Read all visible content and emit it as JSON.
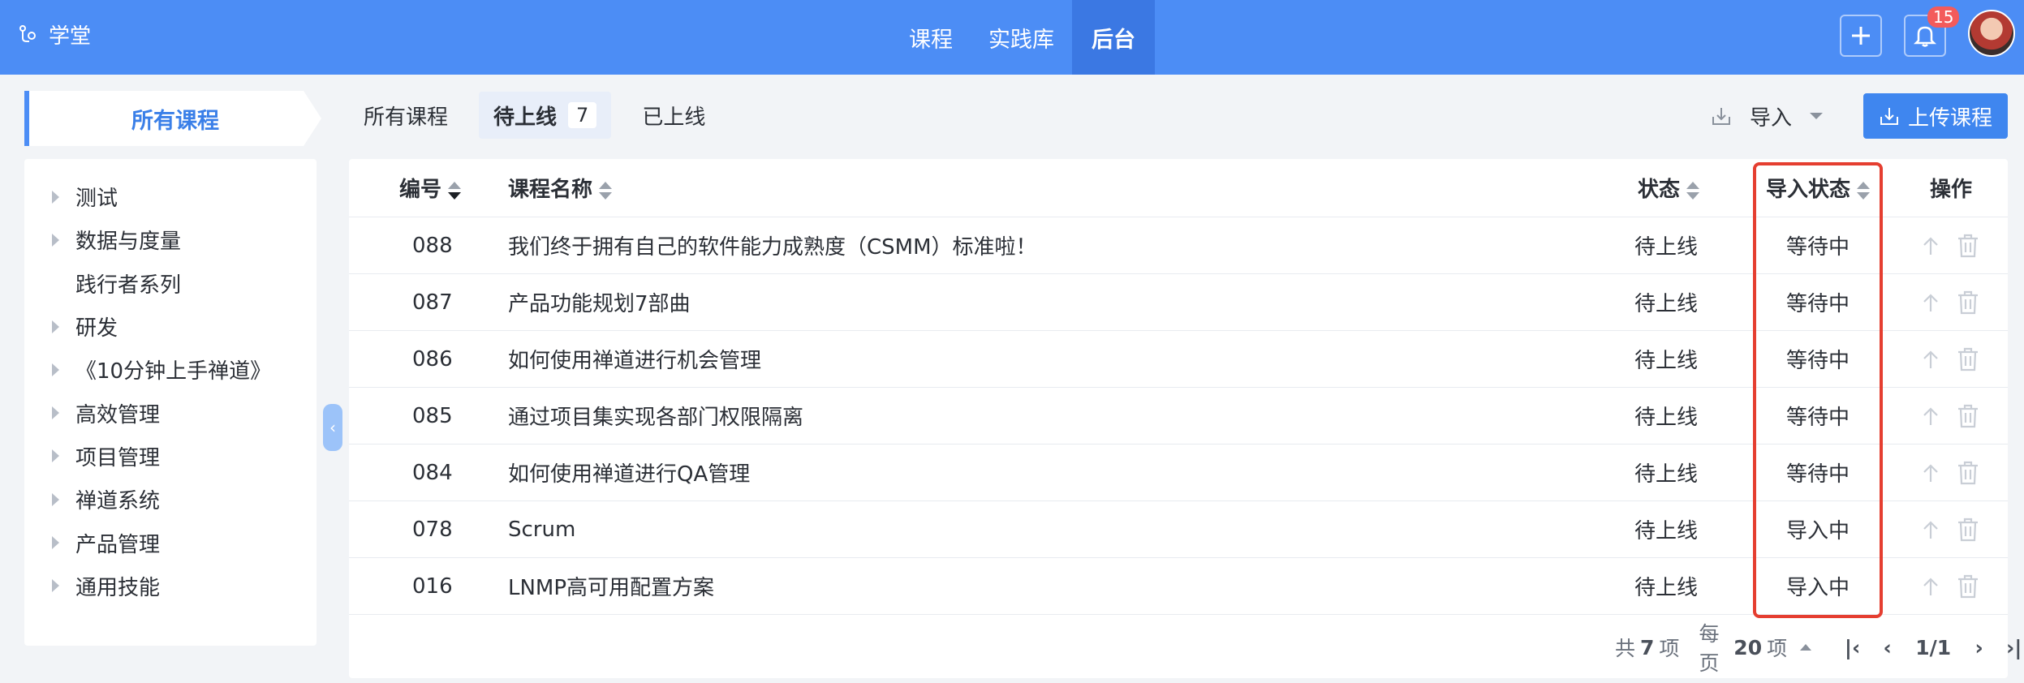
{
  "header": {
    "brand": "学堂",
    "nav": [
      {
        "label": "课程"
      },
      {
        "label": "实践库"
      },
      {
        "label": "后台"
      }
    ],
    "notification_count": "15"
  },
  "sidebar": {
    "title": "所有课程",
    "items": [
      {
        "label": "测试",
        "expandable": true
      },
      {
        "label": "数据与度量",
        "expandable": true
      },
      {
        "label": "践行者系列",
        "expandable": false
      },
      {
        "label": "研发",
        "expandable": true
      },
      {
        "label": "《10分钟上手禅道》",
        "expandable": true
      },
      {
        "label": "高效管理",
        "expandable": true
      },
      {
        "label": "项目管理",
        "expandable": true
      },
      {
        "label": "禅道系统",
        "expandable": true
      },
      {
        "label": "产品管理",
        "expandable": true
      },
      {
        "label": "通用技能",
        "expandable": true
      }
    ]
  },
  "tabs": [
    {
      "label": "所有课程",
      "count": null
    },
    {
      "label": "待上线",
      "count": "7"
    },
    {
      "label": "已上线",
      "count": null
    }
  ],
  "toolbar": {
    "import_label": "导入",
    "upload_label": "上传课程"
  },
  "table": {
    "columns": {
      "id": "编号",
      "name": "课程名称",
      "status": "状态",
      "import_status": "导入状态",
      "ops": "操作"
    },
    "rows": [
      {
        "id": "088",
        "name": "我们终于拥有自己的软件能力成熟度（CSMM）标准啦！",
        "status": "待上线",
        "import_status": "等待中"
      },
      {
        "id": "087",
        "name": "产品功能规划7部曲",
        "status": "待上线",
        "import_status": "等待中"
      },
      {
        "id": "086",
        "name": "如何使用禅道进行机会管理",
        "status": "待上线",
        "import_status": "等待中"
      },
      {
        "id": "085",
        "name": "通过项目集实现各部门权限隔离",
        "status": "待上线",
        "import_status": "等待中"
      },
      {
        "id": "084",
        "name": "如何使用禅道进行QA管理",
        "status": "待上线",
        "import_status": "等待中"
      },
      {
        "id": "078",
        "name": "Scrum",
        "status": "待上线",
        "import_status": "导入中"
      },
      {
        "id": "016",
        "name": "LNMP高可用配置方案",
        "status": "待上线",
        "import_status": "导入中"
      }
    ]
  },
  "pager": {
    "total_prefix": "共",
    "total": "7",
    "total_suffix": "项",
    "per_page_prefix": "每页",
    "per_page": "20",
    "per_page_suffix": "项",
    "page": "1/1"
  },
  "colors": {
    "header_bg": "#4c8df5",
    "accent": "#3f86ef",
    "highlight_border": "#e53e30",
    "badge": "#f35b5b"
  }
}
